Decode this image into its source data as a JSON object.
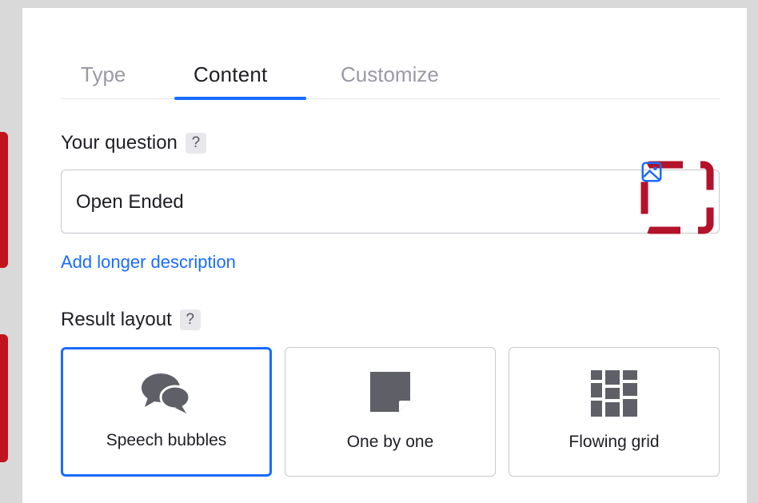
{
  "tabs": [
    {
      "label": "Type"
    },
    {
      "label": "Content"
    },
    {
      "label": "Customize"
    }
  ],
  "question": {
    "label": "Your question",
    "help": "?",
    "value": "Open Ended",
    "image_icon": "image-icon"
  },
  "description_link": "Add longer description",
  "result_layout": {
    "label": "Result layout",
    "help": "?",
    "options": [
      {
        "label": "Speech bubbles",
        "icon": "speech-bubbles-icon",
        "selected": true
      },
      {
        "label": "One by one",
        "icon": "sticky-note-icon",
        "selected": false
      },
      {
        "label": "Flowing grid",
        "icon": "grid-icon",
        "selected": false
      }
    ]
  },
  "colors": {
    "accent": "#196cff",
    "marker": "#c0141e",
    "highlight_dashed": "#b3122a"
  }
}
